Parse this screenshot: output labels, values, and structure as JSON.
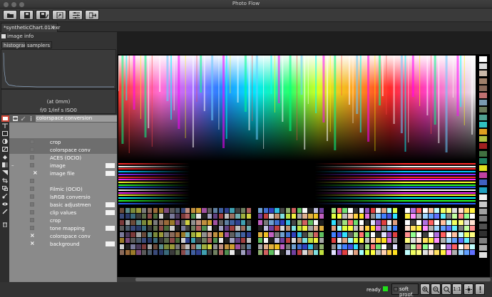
{
  "window": {
    "title": "Photo Flow"
  },
  "toolbar": {
    "buttons": [
      {
        "icon": "folder-open-icon"
      },
      {
        "icon": "save-icon"
      },
      {
        "icon": "save-as-icon"
      },
      {
        "icon": "export-icon"
      },
      {
        "icon": "settings-sliders-icon"
      },
      {
        "icon": "exit-icon"
      }
    ]
  },
  "tab": {
    "label": "*syntheticChart.01.exr",
    "close": "✕"
  },
  "image_info": {
    "label": "image info",
    "subtabs": [
      "histogram",
      "samplers"
    ],
    "position_text": "(at 0mm)",
    "exposure_text": "f/0   1/inf s  ISO0"
  },
  "layers": {
    "header_label": "colorspace conversion",
    "rows": [
      {
        "name": "crop",
        "mark": "box",
        "sel": true
      },
      {
        "name": "colorspace conv",
        "mark": "box",
        "sel": true
      },
      {
        "name": "ACES (OCIO)",
        "mark": "box"
      },
      {
        "name": "image",
        "mark": "box",
        "value_box": true,
        "minus": true
      },
      {
        "name": "image file",
        "mark": "x",
        "value_box": true,
        "indent": true
      },
      {
        "name": "",
        "mark": "box"
      },
      {
        "name": "Filmic (OCIO)",
        "mark": "box"
      },
      {
        "name": "lsRGB conversio",
        "mark": "box"
      },
      {
        "name": "basic adjustmen",
        "mark": "box",
        "value_box": true
      },
      {
        "name": "clip values",
        "mark": "box",
        "value_box": true
      },
      {
        "name": "crop",
        "mark": "box"
      },
      {
        "name": "tone mapping",
        "mark": "box",
        "value_box": true
      },
      {
        "name": "colorspace conv",
        "mark": "x"
      },
      {
        "name": "background",
        "mark": "x",
        "value_box": true
      }
    ]
  },
  "status": {
    "ready": "ready",
    "ready_color": "#21e019",
    "soft_proof": "soft proof.",
    "zoom_buttons": [
      "zoom-in-icon",
      "zoom-out-icon",
      "zoom-fit-icon",
      "1:1",
      "brightness-icon",
      "exclamation-icon"
    ]
  }
}
